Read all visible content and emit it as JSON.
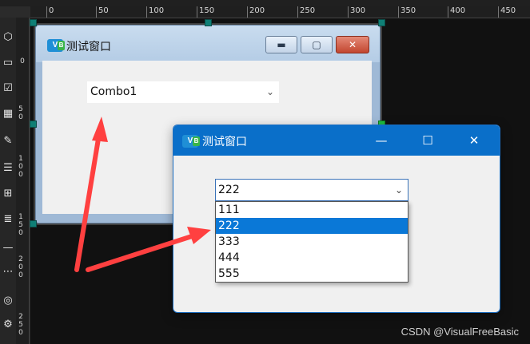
{
  "ruler_top": [
    "0",
    "50",
    "100",
    "150",
    "200",
    "250",
    "300",
    "350",
    "400",
    "450"
  ],
  "ruler_left": [
    "0",
    "5 0",
    "1 0 0",
    "1 5 0",
    "2 0 0",
    "2 5 0"
  ],
  "toolbox": {
    "icons": [
      "shapes-icon",
      "textbox-icon",
      "checkbox-icon",
      "grid-icon",
      "pen-icon",
      "list-icon",
      "apps-icon",
      "align-icon",
      "minus-icon",
      "dots-icon",
      "chrome-icon",
      "bell-icon"
    ]
  },
  "designer_window": {
    "title": "测试窗口",
    "icon_label": "V",
    "combo_text": "Combo1"
  },
  "runtime_window": {
    "title": "测试窗口",
    "icon_label": "V",
    "combo_value": "222",
    "options": [
      "111",
      "222",
      "333",
      "444",
      "555"
    ],
    "selected_index": 1
  },
  "colors": {
    "accent_blue": "#0a6fc9",
    "selection_blue": "#0a78d7",
    "arrow_red": "#ff4040",
    "handle_teal": "#0f7f76"
  },
  "watermark": "CSDN @VisualFreeBasic"
}
